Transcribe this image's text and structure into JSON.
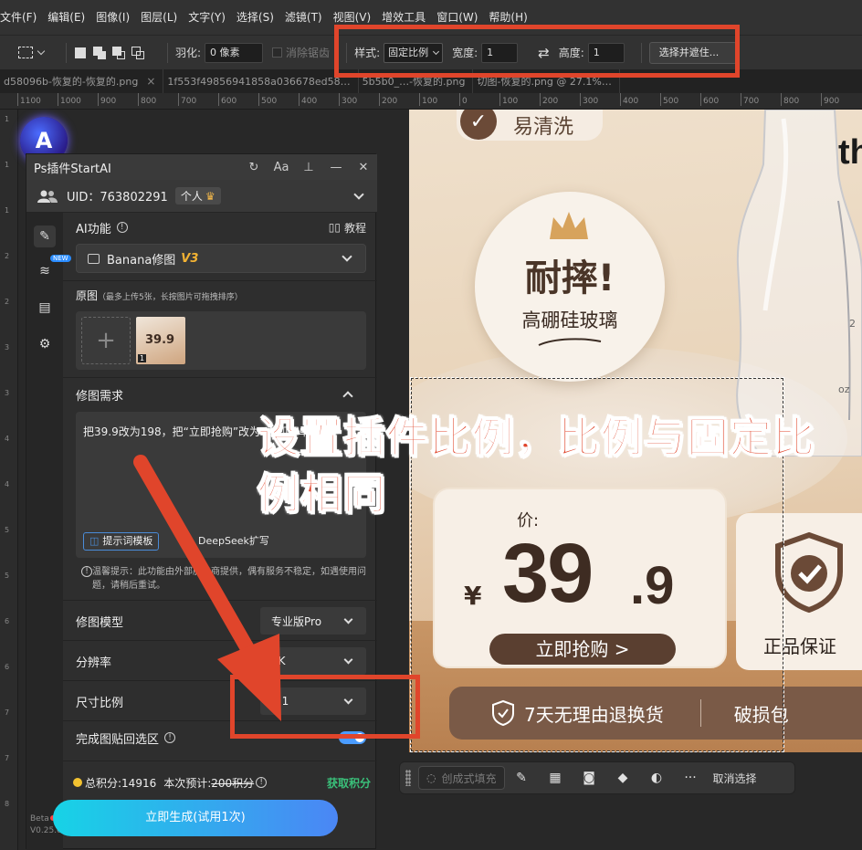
{
  "menu": [
    "文件(F)",
    "编辑(E)",
    "图像(I)",
    "图层(L)",
    "文字(Y)",
    "选择(S)",
    "滤镜(T)",
    "视图(V)",
    "增效工具",
    "窗口(W)",
    "帮助(H)"
  ],
  "options_bar": {
    "feather_label": "羽化:",
    "feather_value": "0 像素",
    "antialias_label": "消除锯齿",
    "style_label": "样式:",
    "style_value": "固定比例",
    "width_label": "宽度:",
    "width_value": "1",
    "height_label": "高度:",
    "height_value": "1",
    "select_mask_button": "选择并遮住..."
  },
  "tabs": [
    "d58096b-恢复的-恢复的.png",
    "1f553f49856941858a036678ed58…",
    "5b5b0_…-恢复的.png",
    "切图-恢复的.png @ 27.1%…"
  ],
  "ruler_h": [
    "1100",
    "1000",
    "900",
    "800",
    "700",
    "600",
    "500",
    "400",
    "300",
    "200",
    "100",
    "0",
    "100",
    "200",
    "300",
    "400",
    "500",
    "600",
    "700",
    "800",
    "900"
  ],
  "ruler_v": [
    "1",
    "1",
    "1",
    "2",
    "2",
    "3",
    "3",
    "4",
    "4",
    "5",
    "5",
    "6",
    "6",
    "7",
    "7",
    "8"
  ],
  "plugin": {
    "title": "Ps插件StartAI",
    "uid": "UID：763802291",
    "account_type": "个人",
    "ai_section_title": "AI功能",
    "tutorial_label": "教程",
    "model_name": "Banana修图",
    "model_version": "V3",
    "original_title": "原图",
    "original_hint": "（最多上传5张，长按图片可拖拽排序）",
    "thumb_price": "39.9",
    "thumb_index": "1",
    "requirement_title": "修图需求",
    "requirement_text": "把39.9改为198，把“立即抢购”改为“立即下单”",
    "prompt_template_button": "提示词模板",
    "deepseek_button": "DeepSeek扩写",
    "notice": "温馨提示：此功能由外部服务商提供，偶有服务不稳定，如遇使用问题，请稍后重试。",
    "model_label": "修图模型",
    "model_value": "专业版Pro",
    "resolution_label": "分辨率",
    "resolution_value": "2K",
    "ratio_label": "尺寸比例",
    "ratio_value": "1:1",
    "paste_back_label": "完成图贴回选区",
    "paste_back_on": true,
    "total_points": "总积分:14916",
    "estimate_label": "本次预计:",
    "estimate_value": "200积分",
    "get_points": "获取积分",
    "generate_button": "立即生成(试用1次)",
    "beta": "Beta",
    "version": "V0.25.0",
    "new_badge": "NEW"
  },
  "canvas": {
    "top_badge": "易清洗",
    "brand": "th",
    "circle_main": "耐摔!",
    "circle_sub": "高硼硅玻璃",
    "price_label": "价:",
    "currency": "¥",
    "price_int": "39",
    "price_dec": ".9",
    "buy_button": "立即抢购 >",
    "genuine": "正品保证",
    "return_policy": "7天无理由退换货",
    "broken": "破损包",
    "measure_1": "2",
    "measure_2": "oz"
  },
  "context_bar": {
    "generative_fill": "创成式填充",
    "deselect": "取消选择"
  },
  "annotation": {
    "text": "设置插件比例，比例与固定比例相同",
    "color": "#e0452b"
  }
}
